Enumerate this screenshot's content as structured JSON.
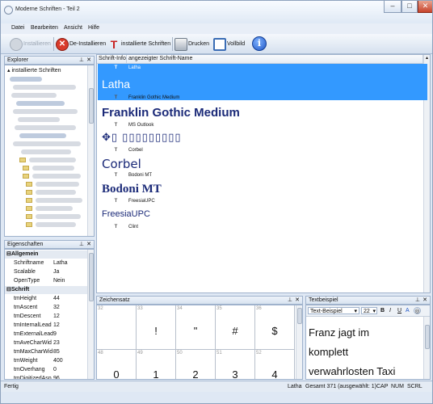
{
  "window": {
    "title": "Moderne Schriften - Teil 2",
    "controls": [
      "–",
      "□",
      "✕"
    ]
  },
  "menu": [
    "Datei",
    "Bearbeiten",
    "Ansicht",
    "Hilfe"
  ],
  "toolbar": {
    "install": "Installieren",
    "uninstall": "De-Installieren",
    "installed_fonts": "installierte Schriften",
    "print": "Drucken",
    "fullscreen": "Vollbild",
    "info_icon": "info-icon"
  },
  "explorer": {
    "title": "Explorer",
    "root": "installierte Schriften"
  },
  "properties": {
    "title": "Eigenschaften",
    "categories": [
      {
        "name": "Allgemein",
        "rows": [
          {
            "key": "Schriftname",
            "value": "Latha"
          },
          {
            "key": "Scalable",
            "value": "Ja"
          },
          {
            "key": "OpenType",
            "value": "Nein"
          }
        ]
      },
      {
        "name": "Schrift",
        "rows": [
          {
            "key": "tmHeight",
            "value": "44"
          },
          {
            "key": "tmAscent",
            "value": "32"
          },
          {
            "key": "tmDescent",
            "value": "12"
          },
          {
            "key": "tmInternalLead",
            "value": "12"
          },
          {
            "key": "tmExternalLead",
            "value": "9"
          },
          {
            "key": "tmAveCharWid",
            "value": "23"
          },
          {
            "key": "tmMaxCharWid",
            "value": "85"
          },
          {
            "key": "tmWeight",
            "value": "400"
          },
          {
            "key": "tmOverhang",
            "value": "0"
          },
          {
            "key": "tmDigitizedAsp",
            "value": "96"
          }
        ]
      }
    ]
  },
  "fontlist": {
    "columns": [
      "Schrift-Info",
      "angezeigter Schrift-Name"
    ],
    "items": [
      {
        "name": "Latha",
        "sample": "Latha",
        "selected": true
      },
      {
        "name": "Franklin Gothic Medium",
        "sample": "Franklin Gothic Medium"
      },
      {
        "name": "MS Outlook",
        "sample": "✥▯ ▯▯▯▯▯▯▯▯▯"
      },
      {
        "name": "Corbel",
        "sample": "Corbel"
      },
      {
        "name": "Bodoni MT",
        "sample": "Bodoni MT"
      },
      {
        "name": "FreesiaUPC",
        "sample": "FreesiaUPC"
      },
      {
        "name": "Clint",
        "sample": ""
      }
    ]
  },
  "charset": {
    "title": "Zeichensatz",
    "row1": [
      {
        "code": "32",
        "char": ""
      },
      {
        "code": "33",
        "char": "!"
      },
      {
        "code": "34",
        "char": "\""
      },
      {
        "code": "35",
        "char": "#"
      },
      {
        "code": "36",
        "char": "$"
      }
    ],
    "row2": [
      {
        "code": "48",
        "char": "0"
      },
      {
        "code": "49",
        "char": "1"
      },
      {
        "code": "50",
        "char": "2"
      },
      {
        "code": "51",
        "char": "3"
      },
      {
        "code": "52",
        "char": "4"
      }
    ]
  },
  "example": {
    "title": "Textbeispiel",
    "style": "Text-Beispiel",
    "size": "22",
    "format_buttons": [
      "B",
      "I",
      "U",
      "A"
    ],
    "text": [
      "Franz jagt im",
      "komplett",
      "verwahrlosten Taxi"
    ]
  },
  "status": {
    "left": "Fertig",
    "font": "Latha",
    "total": "Gesamt 371 (ausgewählt: 1)",
    "caps": "CAP",
    "num": "NUM",
    "scrl": "SCRL"
  },
  "colors": {
    "selection": "#3399ff",
    "accent_text": "#1b2a78"
  }
}
